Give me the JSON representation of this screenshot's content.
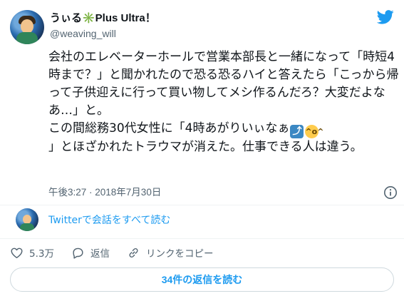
{
  "colors": {
    "accent": "#1d9bf0",
    "text": "#0f1419",
    "muted": "#536471",
    "border": "#cfd9de"
  },
  "author": {
    "display_name": "うぃる✳️Plus Ultra！",
    "handle": "@weaving_will"
  },
  "tweet": {
    "text_part1": "会社のエレベーターホールで営業本部長と一緒になって「時短4時まで？」と聞かれたので恐る恐るハイと答えたら「こっから帰って子供迎えに行って買い物してメシ作るんだろ？大変だよなあ…」と。\nこの間総務30代女性に「4時あがりいぃなぁ",
    "text_part2": "\n」とほざかれたトラウマが消えた。仕事できる人は違う。",
    "emoji": [
      "arrow-upper-right-emoji",
      "laughing-face-emoji"
    ],
    "timestamp": "午後3:27 · 2018年7月30日"
  },
  "thread": {
    "link_text": "Twitterで会話をすべて読む"
  },
  "actions": {
    "likes": "5.3万",
    "reply_label": "返信",
    "copy_link_label": "リンクをコピー"
  },
  "replies_button": "34件の返信を読む"
}
